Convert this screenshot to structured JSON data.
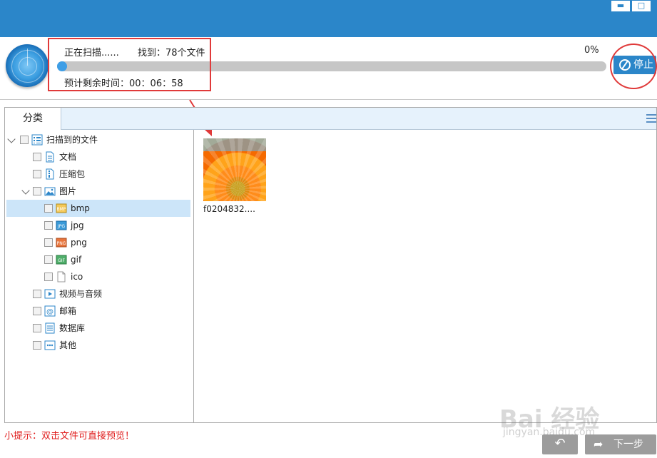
{
  "window": {
    "minimize": "▬",
    "maximize": "□"
  },
  "scan": {
    "status": "正在扫描......",
    "found": "找到：78个文件",
    "percent_label": "0%",
    "progress": 0.01,
    "remaining": "预计剩余时间：00：06：58",
    "stop_label": "停止"
  },
  "tabs": [
    {
      "label": "分类"
    }
  ],
  "tree": {
    "root": "扫描到的文件",
    "items": [
      {
        "label": "文档",
        "icon": "document-icon"
      },
      {
        "label": "压缩包",
        "icon": "archive-icon"
      },
      {
        "label": "图片",
        "icon": "image-icon"
      },
      {
        "label": "bmp",
        "icon": "bmp-icon"
      },
      {
        "label": "jpg",
        "icon": "jpg-icon"
      },
      {
        "label": "png",
        "icon": "png-icon"
      },
      {
        "label": "gif",
        "icon": "gif-icon"
      },
      {
        "label": "ico",
        "icon": "file-icon"
      },
      {
        "label": "视频与音频",
        "icon": "video-icon"
      },
      {
        "label": "邮箱",
        "icon": "at-icon"
      },
      {
        "label": "数据库",
        "icon": "database-icon"
      },
      {
        "label": "其他",
        "icon": "more-icon"
      }
    ]
  },
  "files": [
    {
      "name": "f0204832...."
    }
  ],
  "hint": "小提示：双击文件可直接预览！",
  "footer": {
    "back": "↶",
    "next": "下一步"
  },
  "colors": {
    "accent": "#2b86c9",
    "highlight": "#e03a3a",
    "selection": "#cce5f9"
  }
}
